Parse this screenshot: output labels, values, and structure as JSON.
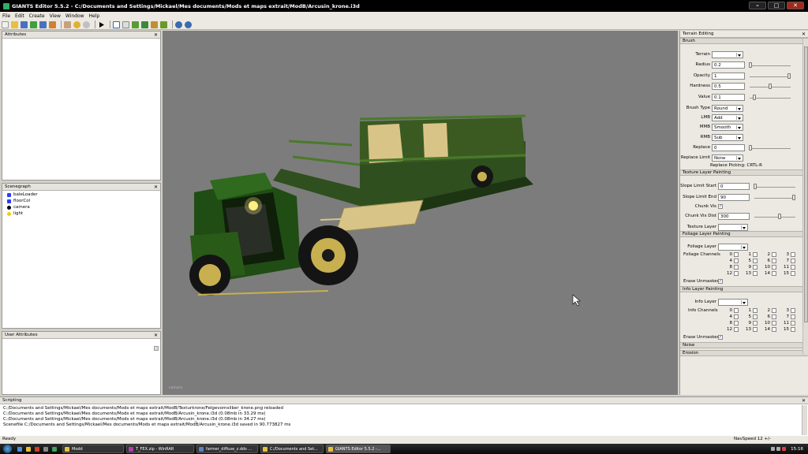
{
  "app": {
    "title": "GIANTS Editor 5.5.2 - C:/Documents and Settings/Mickael/Mes documents/Mods et maps extrait/ModB/Arcusin_krone.i3d"
  },
  "window_controls": {
    "minimize": "–",
    "maximize": "□",
    "close": "✕"
  },
  "menu": [
    "File",
    "Edit",
    "Create",
    "View",
    "Window",
    "Help"
  ],
  "toolbar_icons": [
    "new-icon",
    "open-icon",
    "save-icon",
    "reload-icon",
    "save-as-icon",
    "export-icon",
    "hand-icon",
    "undo-icon",
    "redo-icon",
    "play-icon",
    "select-icon",
    "translate-icon",
    "terrain-icon",
    "foliage-icon",
    "paint-icon",
    "gear-icon",
    "settings-icon"
  ],
  "panels": {
    "attributes": {
      "title": "Attributes",
      "close": "✕"
    },
    "scenegraph": {
      "title": "Scenegraph",
      "close": "✕",
      "items": [
        {
          "label": "baleLoader",
          "icon": "transform-group-icon",
          "color": "#2a3cff"
        },
        {
          "label": "floorCol",
          "icon": "transform-group-icon",
          "color": "#2a3cff"
        },
        {
          "label": "camera",
          "icon": "camera-icon",
          "color": "#000000"
        },
        {
          "label": "light",
          "icon": "light-icon",
          "color": "#f4d000"
        }
      ]
    },
    "user_attributes": {
      "title": "User Attributes",
      "close": "✕"
    }
  },
  "viewport": {
    "camera_label": "camera"
  },
  "terrain_editing": {
    "title": "Terrain Editing",
    "close": "✕",
    "brush": {
      "title": "Brush",
      "terrain_label": "Terrain",
      "terrain_value": "",
      "radius_label": "Radius",
      "radius_value": "0.2",
      "opacity_label": "Opacity",
      "opacity_value": "1",
      "hardness_label": "Hardness",
      "hardness_value": "0.5",
      "value_label": "Value",
      "value_value": "0.1",
      "brush_type_label": "Brush Type",
      "brush_type_value": "Round",
      "lmb_label": "LMB",
      "lmb_value": "Add",
      "mmb_label": "MMB",
      "mmb_value": "Smooth",
      "rmb_label": "RMB",
      "rmb_value": "Sub",
      "replace_label": "Replace",
      "replace_value": "0",
      "replace_limit_label": "Replace Limit",
      "replace_limit_value": "None",
      "replace_picking": "Replace Picking: CRTL-R"
    },
    "texture": {
      "title": "Texture Layer Painting",
      "slope_start_label": "Slope Limit Start",
      "slope_start_value": "0",
      "slope_end_label": "Slope Limit End",
      "slope_end_value": "90",
      "chunk_vis_label": "Chunk Vis",
      "chunk_vis_dist_label": "Chunk Vis Dist",
      "chunk_vis_dist_value": "300",
      "texture_layer_label": "Texture Layer",
      "texture_layer_value": ""
    },
    "foliage": {
      "title": "Foliage Layer Painting",
      "layer_label": "Foliage Layer",
      "layer_value": "",
      "channels_label": "Foliage Channels",
      "channels": [
        "0",
        "1",
        "2",
        "3",
        "4",
        "5",
        "6",
        "7",
        "8",
        "9",
        "10",
        "11",
        "12",
        "13",
        "14",
        "15"
      ],
      "erase_label": "Erase Unmasked"
    },
    "info": {
      "title": "Info Layer Painting",
      "layer_label": "Info Layer",
      "layer_value": "",
      "channels_label": "Info Channels",
      "channels": [
        "0",
        "1",
        "2",
        "3",
        "4",
        "5",
        "6",
        "7",
        "8",
        "9",
        "10",
        "11",
        "12",
        "13",
        "14",
        "15"
      ],
      "erase_label": "Erase Unmasked"
    },
    "noise": {
      "title": "Noise"
    },
    "erosion": {
      "title": "Erosion"
    }
  },
  "scripting": {
    "title": "Scripting",
    "close": "✕",
    "lines": [
      "C:/Documents and Settings/Mickael/Mes documents/Mods et maps extrait/ModB/Texturkrone/Felgevornsilber_krone.png reloaded",
      "C:/Documents and Settings/Mickael/Mes documents/Mods et maps extrait/ModB/Arcusin_krone.i3d (0.08mb in 33.29 ms)",
      "C:/Documents and Settings/Mickael/Mes documents/Mods et maps extrait/ModB/Arcusin_krone.i3d (0.08mb in 34.27 ms)",
      "Scenefile C:/Documents and Settings/Mickael/Mes documents/Mods et maps extrait/ModB/Arcusin_krone.i3d saved in 90.773827 ms"
    ]
  },
  "status": {
    "left": "Ready",
    "right": "NavSpeed 12 +/-"
  },
  "taskbar": {
    "tasks": [
      {
        "label": "Modd",
        "icon": "folder-icon",
        "color": "#e8c040"
      },
      {
        "label": "T_FEX.zip - WinRAR",
        "icon": "winrar-icon",
        "color": "#b040b0"
      },
      {
        "label": "farmer_diffuse_z.dds ...",
        "icon": "image-icon",
        "color": "#6080c0"
      },
      {
        "label": "C:/Documents and Set...",
        "icon": "folder-icon",
        "color": "#e8c040"
      },
      {
        "label": "GIANTS Editor 5.5.2 -...",
        "icon": "giants-icon",
        "color": "#e8c040"
      }
    ],
    "clock": "15:16"
  }
}
